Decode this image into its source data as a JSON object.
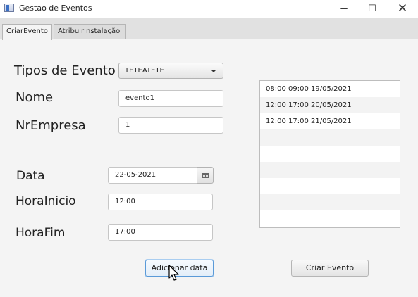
{
  "window": {
    "title": "Gestao de Eventos",
    "min": "−",
    "max": "☐",
    "close": "✕"
  },
  "tabs": [
    {
      "label": "CriarEvento",
      "selected": true
    },
    {
      "label": "AtribuirInstalação",
      "selected": false
    }
  ],
  "form": {
    "tipos_label": "Tipos de Evento",
    "tipos_value": "TETEATETE",
    "nome_label": "Nome",
    "nome_value": "evento1",
    "nrempresa_label": "NrEmpresa",
    "nrempresa_value": "1",
    "data_label": "Data",
    "data_value": "22-05-2021",
    "horainicio_label": "HoraInicio",
    "horainicio_value": "12:00",
    "horafim_label": "HoraFim",
    "horafim_value": "17:00"
  },
  "dates_list": [
    "08:00 09:00 19/05/2021",
    "12:00 17:00 20/05/2021",
    "12:00 17:00 21/05/2021",
    "",
    "",
    "",
    "",
    "",
    ""
  ],
  "buttons": {
    "add_date": "Adicionar data",
    "create_event": "Criar Evento"
  },
  "icons": {
    "calendar": "calendar-icon",
    "dropdown": "chevron-down-icon",
    "cursor": "mouse-pointer-icon"
  }
}
